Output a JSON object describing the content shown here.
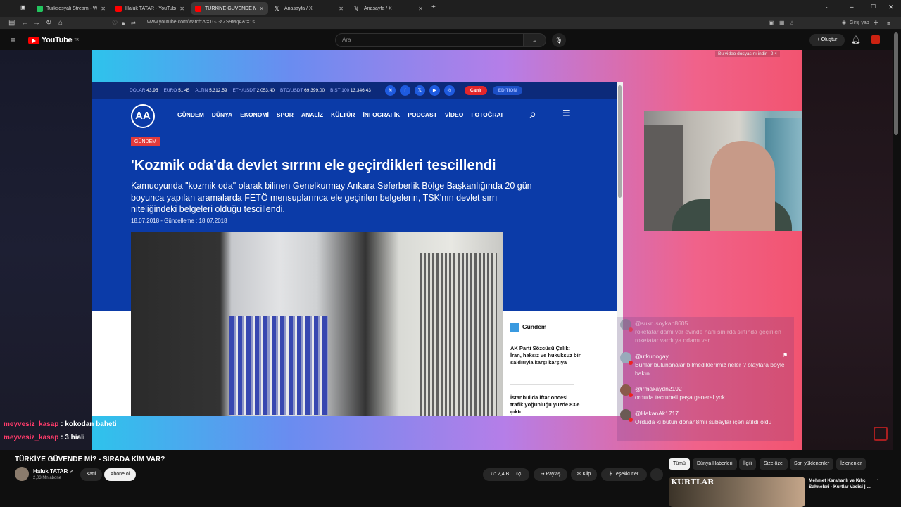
{
  "browser": {
    "tabs": [
      {
        "title": "Turksosyali Stream - Watch",
        "color": "#22c55e"
      },
      {
        "title": "Haluk TATAR - YouTube",
        "color": "#ff0000"
      },
      {
        "title": "TÜRKİYE GÜVENDE Mİ? - SIRAD",
        "color": "#ff0000"
      },
      {
        "title": "Anasayfa / X",
        "color": "#ffffff"
      },
      {
        "title": "Anasayfa / X",
        "color": "#ffffff"
      }
    ],
    "url": "www.youtube.com/watch?v=1GJ-aZS9MqA&t=1s",
    "signin": "Giriş yap"
  },
  "youtube": {
    "logo": "YouTube",
    "logo_region": "TR",
    "search_placeholder": "Ara",
    "create_label": "Oluştur"
  },
  "video": {
    "notice": "Bu video dosyasını indir · 2:4",
    "article": {
      "ticker": [
        {
          "k": "DOLAR",
          "v": "43.95"
        },
        {
          "k": "EURO",
          "v": "51.45"
        },
        {
          "k": "ALTIN",
          "v": "5,312.59"
        },
        {
          "k": "ETH/USDT",
          "v": "2,053.40"
        },
        {
          "k": "BTC/USDT",
          "v": "69,399.00"
        },
        {
          "k": "BIST 100",
          "v": "13,346.43"
        }
      ],
      "live": "Canlı",
      "edition": "EDITION",
      "logo": "AA",
      "nav": [
        "GÜNDEM",
        "DÜNYA",
        "EKONOMİ",
        "SPOR",
        "ANALİZ",
        "KÜLTÜR",
        "İNFOGRAFİK",
        "PODCAST",
        "VİDEO",
        "FOTOĞRAF"
      ],
      "tag": "GÜNDEM",
      "headline": "'Kozmik oda'da devlet sırrını ele geçirdikleri tescillendi",
      "lead": "Kamuoyunda \"kozmik oda\" olarak bilinen Genelkurmay Ankara Seferberlik Bölge Başkanlığında 20 gün boyunca yapılan aramalarda FETÖ mensuplarınca ele geçirilen belgelerin, TSK'nın devlet sırrı niteliğindeki belgeleri olduğu tescillendi.",
      "date": "18.07.2018 - Güncelleme : 18.07.2018",
      "side_tag": "Gündem",
      "side_items": [
        "AK Parti Sözcüsü Çelik: İran, haksız ve hukuksuz bir saldırıyla karşı karşıya",
        "İstanbul'da iftar öncesi trafik yoğunluğu yüzde 83'e çıktı"
      ]
    },
    "chat": [
      {
        "user": "@sukrusoykan8605",
        "text": "roketatar damı var evinde hani sınırda sırtında geçirilen roketatar vardı ya odamı var"
      },
      {
        "user": "@utkunogay",
        "text": "Bunlar bulunanalar bilmediklerimiz neler ? olaylara böyle bakın"
      },
      {
        "user": "@irmakaydn2192",
        "text": "orduda tecrubeli paşa general yok"
      },
      {
        "user": "@HakanAk1717",
        "text": "Orduda ki bütün donan8mlı subaylar içeri atıldı öldü"
      }
    ],
    "overlay_chat": [
      {
        "user": "meyvesiz_kasap",
        "text": ": kokodan baheti"
      },
      {
        "user": "meyvesiz_kasap",
        "text": ": 3 hiali"
      }
    ]
  },
  "info": {
    "title": "TÜRKİYE GÜVENDE Mİ? - SIRADA KİM VAR?",
    "channel": "Haluk TATAR",
    "subs": "2,03 Mn abone",
    "join": "Katıl",
    "subscribe": "Abone ol",
    "likes": "2,4 B",
    "share": "Paylaş",
    "clip": "Klip",
    "thanks": "Teşekkürler",
    "more": "..."
  },
  "chips": [
    "Tümü",
    "Dünya Haberleri",
    "İlgili",
    "Size özel",
    "Son yüklenenler",
    "İzlenenler"
  ],
  "recommended": {
    "thumb_text": "KURTLAR",
    "title": "Mehmet Karahanlı ve Kılıç Sahneleri - Kurtlar Vadisi | ..."
  }
}
